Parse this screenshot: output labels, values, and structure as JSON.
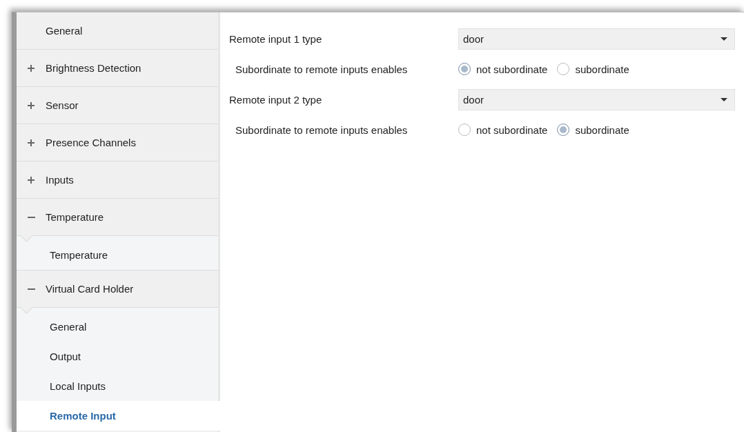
{
  "sidebar": {
    "items": [
      {
        "label": "General",
        "selected": false
      },
      {
        "label": "Brightness Detection",
        "selected": false,
        "expanded": false
      },
      {
        "label": "Sensor",
        "selected": false,
        "expanded": false
      },
      {
        "label": "Presence Channels",
        "selected": false,
        "expanded": false
      },
      {
        "label": "Inputs",
        "selected": false,
        "expanded": false
      },
      {
        "label": "Temperature",
        "selected": false,
        "expanded": true,
        "children": [
          {
            "label": "Temperature",
            "selected": false
          }
        ]
      },
      {
        "label": "Virtual Card Holder",
        "selected": false,
        "expanded": true,
        "children": [
          {
            "label": "General",
            "selected": false
          },
          {
            "label": "Output",
            "selected": false
          },
          {
            "label": "Local Inputs",
            "selected": false
          },
          {
            "label": "Remote Input",
            "selected": true
          }
        ]
      }
    ]
  },
  "parameters": [
    {
      "kind": "dropdown",
      "label": "Remote input 1 type",
      "value": "door"
    },
    {
      "kind": "radio",
      "label": "Subordinate to remote inputs enables",
      "options": [
        {
          "label": "not subordinate",
          "selected": true
        },
        {
          "label": "subordinate",
          "selected": false
        }
      ]
    },
    {
      "kind": "dropdown",
      "label": "Remote input 2 type",
      "value": "door"
    },
    {
      "kind": "radio",
      "label": "Subordinate to remote inputs enables",
      "options": [
        {
          "label": "not subordinate",
          "selected": false
        },
        {
          "label": "subordinate",
          "selected": true
        }
      ]
    }
  ]
}
